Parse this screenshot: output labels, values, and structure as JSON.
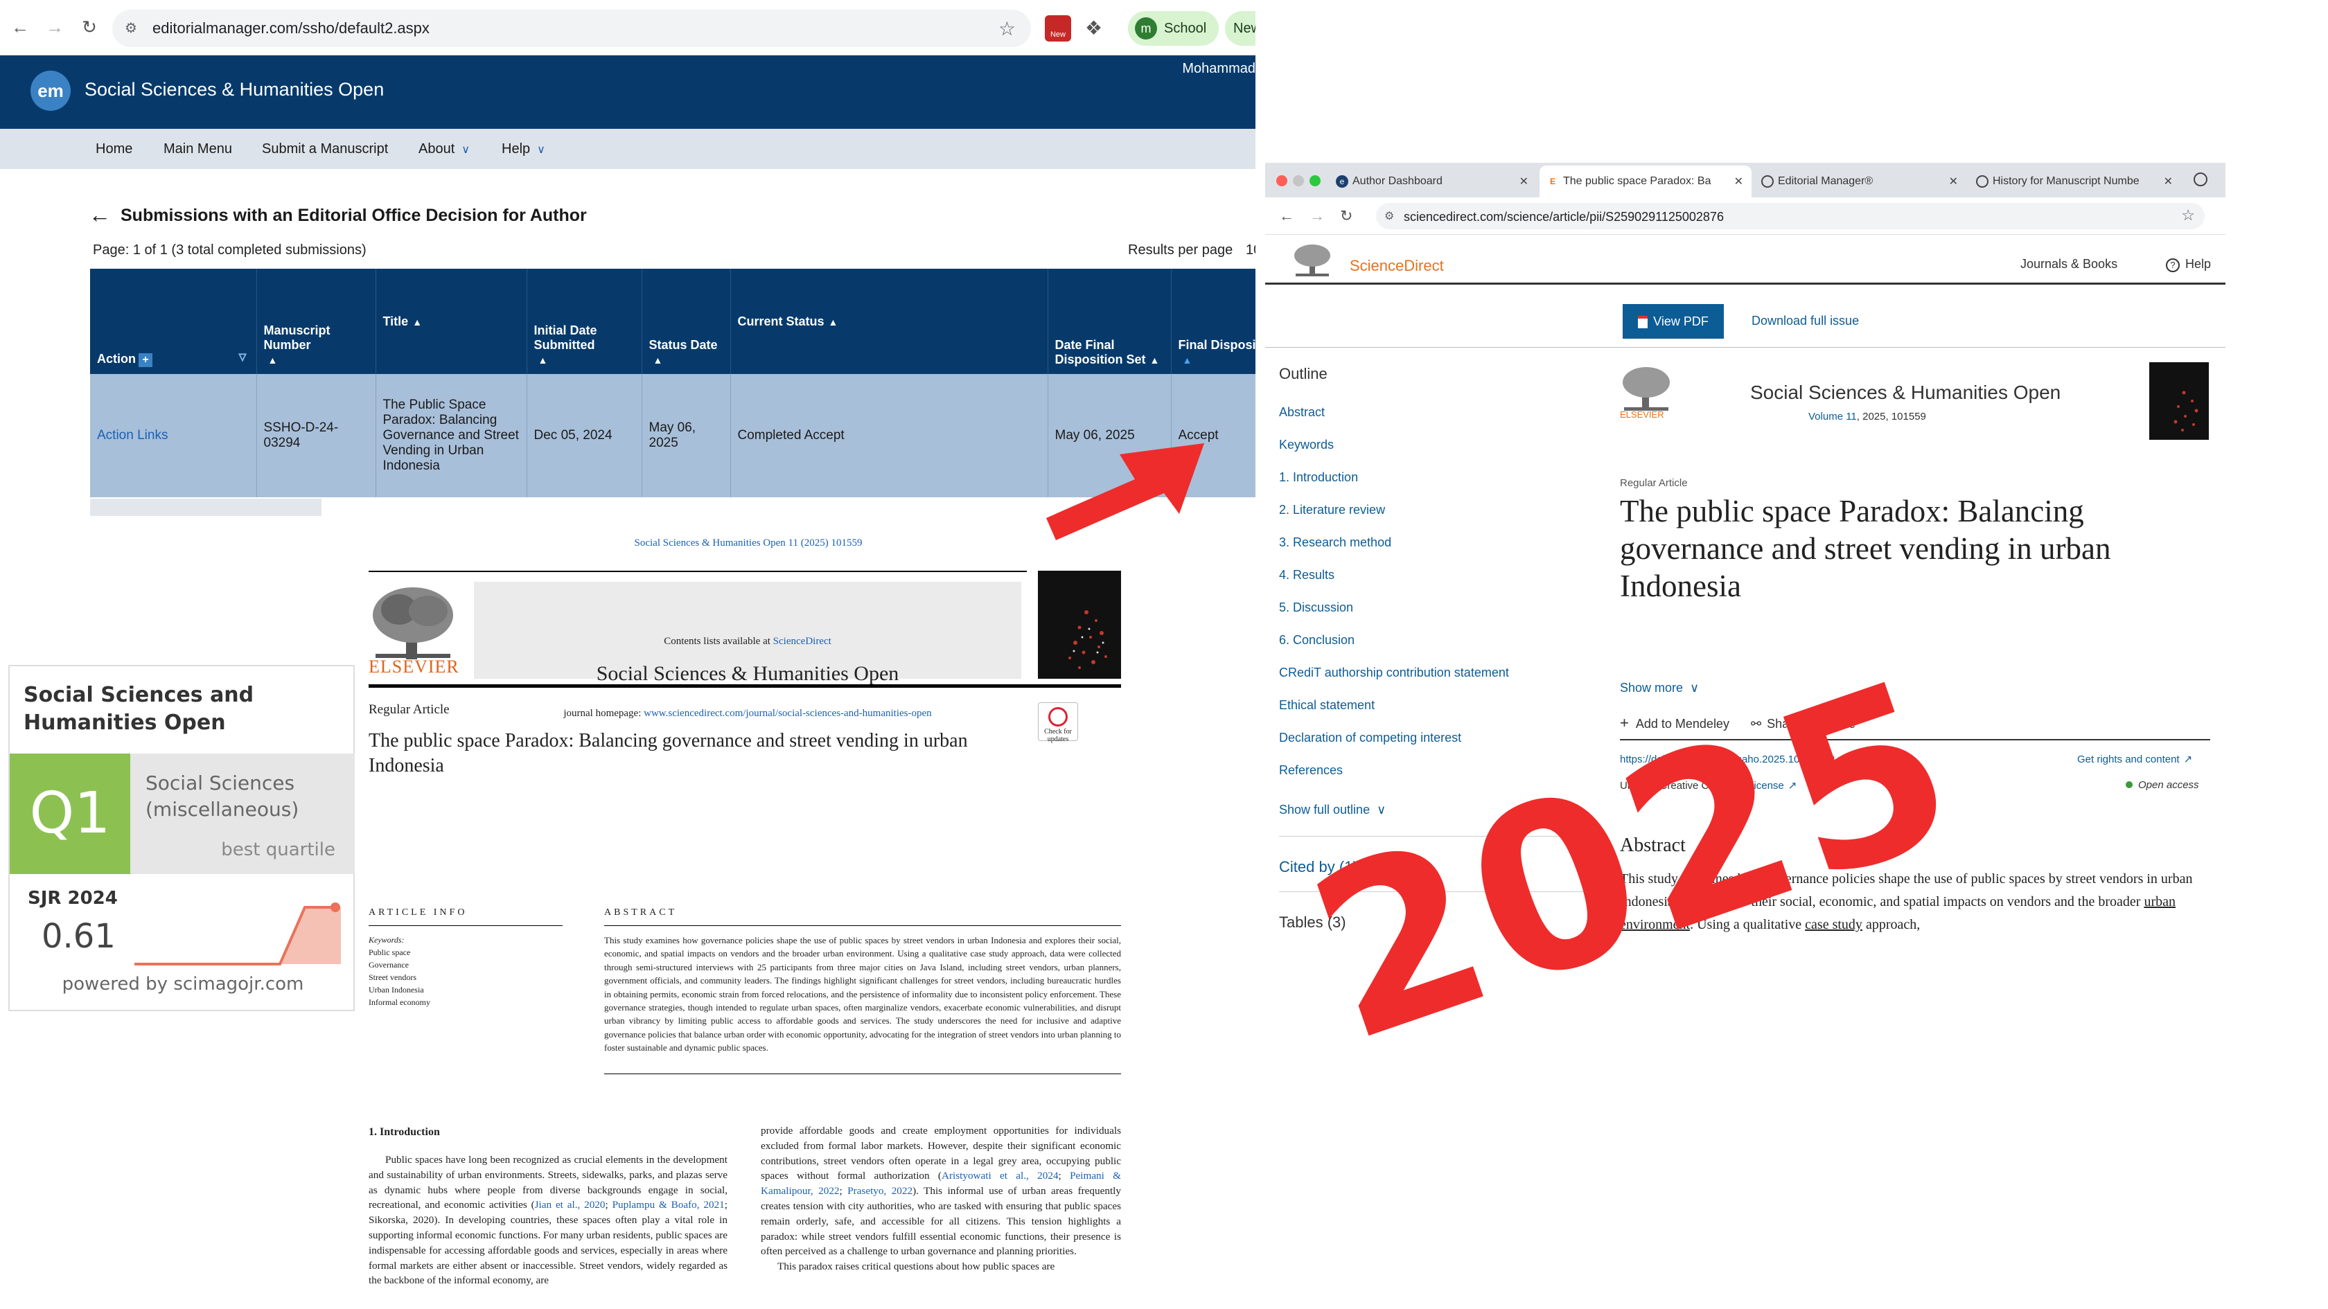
{
  "em": {
    "nav": {
      "back_icon": "arrow-left-icon",
      "forward_icon": "arrow-right-icon",
      "reload_icon": "reload-icon"
    },
    "url": "editorialmanager.com/ssho/default2.aspx",
    "bookmark_pills": [
      {
        "dot": "m",
        "label": "School"
      },
      {
        "label": "New"
      }
    ],
    "logo": "em",
    "journal": "Social Sciences & Humanities Open",
    "user": "Mohammad",
    "menu": {
      "home": "Home",
      "main_menu": "Main Menu",
      "submit": "Submit a Manuscript",
      "about": "About",
      "help": "Help"
    },
    "page_title": "Submissions with an Editorial Office Decision for Author",
    "page_info": "Page: 1 of 1 (3 total completed submissions)",
    "results_per_page_label": "Results per page",
    "results_per_page_value": "10",
    "table": {
      "headers": [
        "Action",
        "Manuscript Number",
        "Title",
        "Initial Date Submitted",
        "Status Date",
        "Current Status",
        "Date Final Disposition Set",
        "Final Disposition"
      ],
      "row": {
        "action": "Action Links",
        "manuscript_number": "SSHO-D-24-03294",
        "title": "The Public Space Paradox: Balancing Governance and Street Vending in Urban Indonesia",
        "initial_date": "Dec 05, 2024",
        "status_date": "May 06, 2025",
        "current_status": "Completed Accept",
        "date_final": "May 06, 2025",
        "final_disposition": "Accept"
      }
    }
  },
  "paper": {
    "citation": "Social Sciences & Humanities Open 11 (2025) 101559",
    "contents_prefix": "Contents lists available at ",
    "contents_link": "ScienceDirect",
    "journal": "Social Sciences & Humanities Open",
    "homepage_prefix": "journal homepage: ",
    "homepage_link": "www.sciencedirect.com/journal/social-sciences-and-humanities-open",
    "publisher": "ELSEVIER",
    "article_type": "Regular Article",
    "title": "The public space Paradox: Balancing governance and street vending in urban Indonesia",
    "check_updates": "Check for updates",
    "article_info_heading": "ARTICLE INFO",
    "keywords_label": "Keywords:",
    "keywords": [
      "Public space",
      "Governance",
      "Street vendors",
      "Urban Indonesia",
      "Informal economy"
    ],
    "abstract_heading": "ABSTRACT",
    "abstract": "This study examines how governance policies shape the use of public spaces by street vendors in urban Indonesia and explores their social, economic, and spatial impacts on vendors and the broader urban environment. Using a qualitative case study approach, data were collected through semi-structured interviews with 25 participants from three major cities on Java Island, including street vendors, urban planners, government officials, and community leaders. The findings highlight significant challenges for street vendors, including bureaucratic hurdles in obtaining permits, economic strain from forced relocations, and the persistence of informality due to inconsistent policy enforcement. These governance strategies, though intended to regulate urban spaces, often marginalize vendors, exacerbate economic vulnerabilities, and disrupt urban vibrancy by limiting public access to affordable goods and services. The study underscores the need for inclusive and adaptive governance policies that balance urban order with economic opportunity, advocating for the integration of street vendors into urban planning to foster sustainable and dynamic public spaces.",
    "intro_heading": "1.  Introduction",
    "col1_a": "Public spaces have long been recognized as crucial elements in the development and sustainability of urban environments. Streets, sidewalks, parks, and plazas serve as dynamic hubs where people from diverse backgrounds engage in social, recreational, and economic activities (",
    "col1_l1": "Jian et al., 2020",
    "col1_s1": "; ",
    "col1_l2": "Puplampu & Boafo, 2021",
    "col1_b": "; Sikorska, 2020). In developing countries, these spaces often play a vital role in supporting informal economic functions. For many urban residents, public spaces are indispensable for accessing affordable goods and services, especially in areas where formal markets are either absent or inaccessible. Street vendors, widely regarded as the backbone of the informal economy, are",
    "col2_a": "provide affordable goods and create employment opportunities for individuals excluded from formal labor markets. However, despite their significant economic contributions, street vendors often operate in a legal grey area, occupying public spaces without formal authorization (",
    "col2_l1": "Aristyowati et al., 2024",
    "col2_s1": "; ",
    "col2_l2": "Peimani & Kamalipour, 2022",
    "col2_s2": "; ",
    "col2_l3": "Prasetyo, 2022",
    "col2_b": "). This informal use of urban areas frequently creates tension with city authorities, who are tasked with ensuring that public spaces remain orderly, safe, and accessible for all citizens. This tension highlights a paradox: while street vendors fulfill essential economic functions, their presence is often perceived as a challenge to urban governance and planning priorities.",
    "col2_c": "This paradox raises critical questions about how public spaces are"
  },
  "sjr": {
    "title_line1": "Social Sciences and",
    "title_line2": "Humanities Open",
    "quartile": "Q1",
    "category_line1": "Social Sciences",
    "category_line2": "(miscellaneous)",
    "best_quartile": "best quartile",
    "label": "SJR 2024",
    "value": "0.61",
    "powered": "powered by scimagojr.com",
    "accent": "#8cc152",
    "trend_color": "#e8735a"
  },
  "sd": {
    "tabs": [
      {
        "label": "Author Dashboard",
        "icon": "em-icon"
      },
      {
        "label": "The public space Paradox: Ba",
        "icon": "elsevier-e-icon"
      },
      {
        "label": "Editorial Manager®",
        "icon": "globe-icon"
      },
      {
        "label": "History for Manuscript Numbe",
        "icon": "globe-icon"
      }
    ],
    "url": "sciencedirect.com/science/article/pii/S2590291125002876",
    "brand": "ScienceDirect",
    "journals_books": "Journals & Books",
    "help": "Help",
    "view_pdf": "View PDF",
    "download_issue": "Download full issue",
    "outline_heading": "Outline",
    "outline": [
      "Abstract",
      "Keywords",
      "1. Introduction",
      "2. Literature review",
      "3. Research method",
      "4. Results",
      "5. Discussion",
      "6. Conclusion",
      "CRediT authorship contribution statement",
      "Ethical statement",
      "Declaration of competing interest",
      "References"
    ],
    "show_full_outline": "Show full outline",
    "cited_by": "Cited by (1)",
    "tables": "Tables (3)",
    "journal": "Social Sciences & Humanities Open",
    "volume_link": "Volume 11",
    "volume_rest": ", 2025, 101559",
    "publisher": "ELSEVIER",
    "article_type": "Regular Article",
    "title": "The public space Paradox: Balancing governance and street vending in urban Indonesia",
    "show_more": "Show more",
    "add_mendeley": "Add to Mendeley",
    "share": "Share",
    "cite": "Cite",
    "doi": "https://doi.org/10.1016/j.ssaho.2025.101559",
    "rights": "Get rights and content",
    "cc_prefix": "Under a Creative Commons ",
    "cc_link": "license",
    "open_access": "Open access",
    "abstract_heading": "Abstract",
    "abstract_a": "This study examines how governance policies shape the use of public spaces by street vendors in urban Indonesia and explores their social, economic, and spatial impacts on vendors and the broader ",
    "abstract_l1": "urban environment",
    "abstract_b": ". Using a qualitative ",
    "abstract_l2": "case study",
    "abstract_c": " approach,"
  },
  "annotation": {
    "year": "2025",
    "color": "#ee2c2c"
  }
}
